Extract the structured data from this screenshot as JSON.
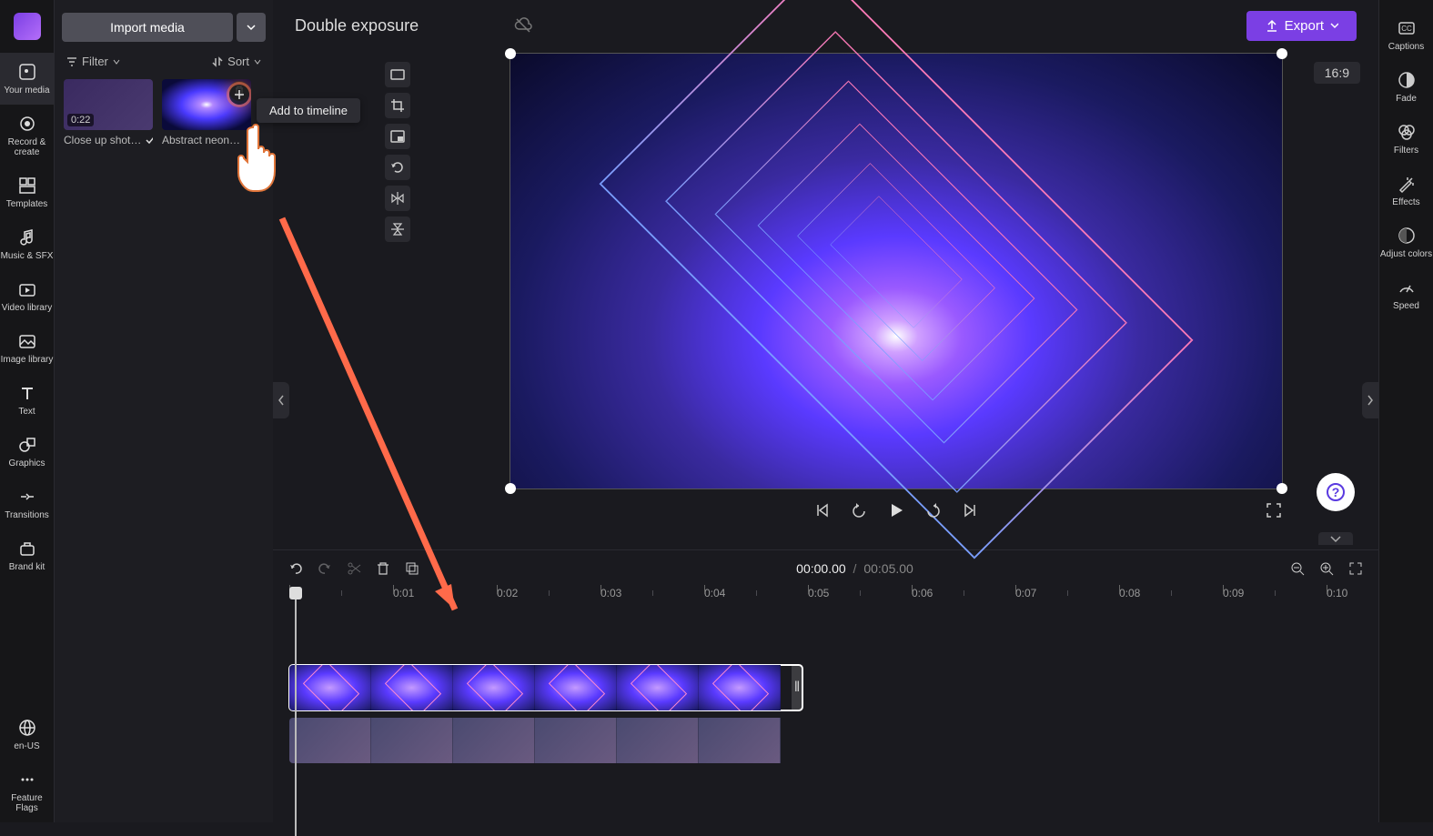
{
  "project_title": "Double exposure",
  "import_label": "Import media",
  "filter_label": "Filter",
  "sort_label": "Sort",
  "tooltip_add": "Add to timeline",
  "export_label": "Export",
  "aspect_ratio": "16:9",
  "playback": {
    "current": "00:00.00",
    "sep": "/",
    "total": "00:05.00"
  },
  "left_rail": [
    {
      "id": "your-media",
      "label": "Your media"
    },
    {
      "id": "record-create",
      "label": "Record & create"
    },
    {
      "id": "templates",
      "label": "Templates"
    },
    {
      "id": "music-sfx",
      "label": "Music & SFX"
    },
    {
      "id": "video-library",
      "label": "Video library"
    },
    {
      "id": "image-library",
      "label": "Image library"
    },
    {
      "id": "text",
      "label": "Text"
    },
    {
      "id": "graphics",
      "label": "Graphics"
    },
    {
      "id": "transitions",
      "label": "Transitions"
    },
    {
      "id": "brand-kit",
      "label": "Brand kit"
    }
  ],
  "left_rail_bottom": [
    {
      "id": "lang",
      "label": "en-US"
    },
    {
      "id": "feature-flags",
      "label": "Feature Flags"
    }
  ],
  "right_rail": [
    {
      "id": "captions",
      "label": "Captions"
    },
    {
      "id": "fade",
      "label": "Fade"
    },
    {
      "id": "filters",
      "label": "Filters"
    },
    {
      "id": "effects",
      "label": "Effects"
    },
    {
      "id": "adjust-colors",
      "label": "Adjust colors"
    },
    {
      "id": "speed",
      "label": "Speed"
    }
  ],
  "media_thumbs": [
    {
      "id": "clip1",
      "label": "Close up shot…",
      "duration": "0:22",
      "in_timeline": true
    },
    {
      "id": "clip2",
      "label": "Abstract neon…",
      "duration": "",
      "in_timeline": false
    }
  ],
  "ruler_ticks": [
    "0",
    "0:01",
    "0:02",
    "0:03",
    "0:04",
    "0:05",
    "0:06",
    "0:07",
    "0:08",
    "0:09",
    "0:10"
  ],
  "colors": {
    "accent": "#7b3fe4",
    "bg": "#1a1a1f"
  }
}
